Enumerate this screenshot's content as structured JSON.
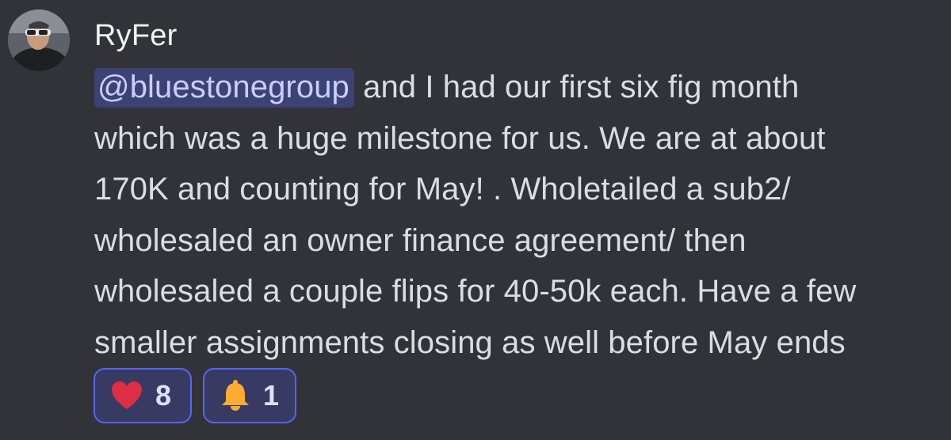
{
  "message": {
    "author": "RyFer",
    "mention": "@bluestonegroup",
    "lines": [
      " and I had our first six fig month",
      "which was a huge milestone for us. We are at about",
      "170K and counting for May! . Wholetailed a sub2/",
      "wholesaled an owner finance agreement/ then",
      "wholesaled a couple flips for 40-50k each. Have a few",
      "smaller assignments closing as well before May ends"
    ]
  },
  "reactions": [
    {
      "emoji": "heart-icon",
      "count": "8"
    },
    {
      "emoji": "bell-icon",
      "count": "1"
    }
  ],
  "colors": {
    "background": "#313338",
    "mention_bg": "#3c4270",
    "reaction_border": "#5865f2",
    "heart": "#dd2e44",
    "bell": "#ffac33"
  }
}
